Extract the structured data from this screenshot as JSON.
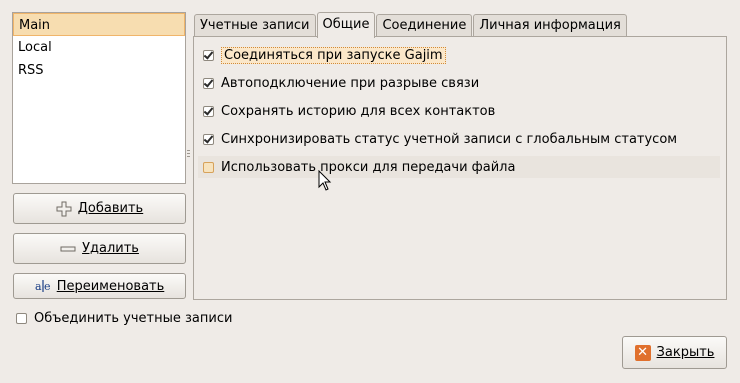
{
  "accounts": {
    "items": [
      {
        "label": "Main",
        "selected": true
      },
      {
        "label": "Local",
        "selected": false
      },
      {
        "label": "RSS",
        "selected": false
      }
    ]
  },
  "buttons": {
    "add": "Добавить",
    "remove": "Удалить",
    "rename": "Переименовать",
    "close": "Закрыть"
  },
  "merge": {
    "label": "Объединить учетные записи",
    "checked": false
  },
  "tabs": [
    {
      "label": "Учетные записи",
      "active": false
    },
    {
      "label": "Общие",
      "active": true
    },
    {
      "label": "Соединение",
      "active": false
    },
    {
      "label": "Личная информация",
      "active": false
    }
  ],
  "options": [
    {
      "label": "Соединяться при запуске Gajim",
      "checked": true
    },
    {
      "label": "Автоподключение при разрыве связи",
      "checked": true
    },
    {
      "label": "Сохранять историю для всех контактов",
      "checked": true
    },
    {
      "label": "Синхронизировать статус учетной записи с глобальным статусом",
      "checked": true
    },
    {
      "label": "Использовать прокси для передачи файла",
      "checked": false
    }
  ],
  "colors": {
    "accent": "#e0702d",
    "selection": "#f7ddb0"
  }
}
